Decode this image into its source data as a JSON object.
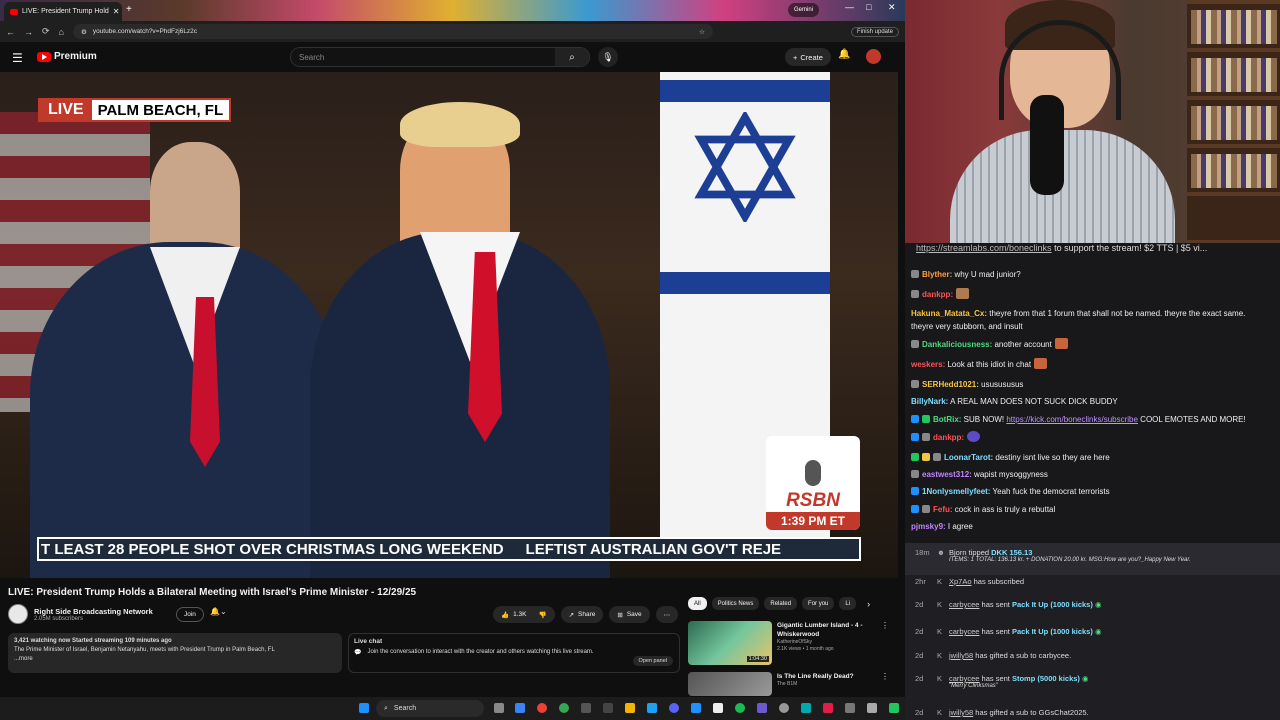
{
  "browser": {
    "tab_title": "LIVE: President Trump Hold",
    "gemini_label": "Gemini",
    "url": "youtube.com/watch?v=PhdFzj6Lz2c",
    "finish_update": "Finish update"
  },
  "youtube": {
    "brand": "Premium",
    "search_placeholder": "Search",
    "create_label": "Create",
    "video": {
      "live_badge": "LIVE",
      "location": "PALM BEACH, FL",
      "rsbn_name": "RSBN",
      "rsbn_time": "1:39 PM ET",
      "ticker_1": "T LEAST 28 PEOPLE SHOT OVER CHRISTMAS LONG WEEKEND",
      "ticker_2": "LEFTIST AUSTRALIAN GOV'T REJE"
    },
    "title": "LIVE: President Trump Holds a Bilateral Meeting with Israel's Prime Minister - 12/29/25",
    "channel": {
      "name": "Right Side Broadcasting Network",
      "subscribers": "2.05M subscribers",
      "join": "Join"
    },
    "actions": {
      "likes": "1.3K",
      "share": "Share",
      "save": "Save"
    },
    "description": {
      "stats": "3,421 watching now  Started streaming 109 minutes ago",
      "text": "The Prime Minister of Israel, Benjamin Netanyahu, meets with President Trump in Palm Beach, FL",
      "more": "...more"
    },
    "live_chat": {
      "title": "Live chat",
      "body": "Join the conversation to interact with the creator and others watching this live stream.",
      "open_panel": "Open panel"
    },
    "chips": [
      "All",
      "Politics News",
      "Related",
      "For you",
      "Li"
    ],
    "recommendations": [
      {
        "title": "Gigantic Lumber Island - 4 - Whiskerwood",
        "channel": "KatherineOfSky",
        "meta": "2.1K views • 1 month ago",
        "duration": "1:04:30"
      },
      {
        "title": "Is The Line Really Dead?",
        "channel": "The B1M",
        "meta": "",
        "duration": ""
      }
    ]
  },
  "taskbar": {
    "search": "Search"
  },
  "stream": {
    "banner_link": "https://streamlabs.com/boneclinks",
    "banner_text": " to support the stream! $2 TTS | $5 vi..."
  },
  "chat": [
    {
      "user": "Blyther:",
      "color": "#ff9f43",
      "text": " why U mad junior?"
    },
    {
      "user": "dankpp:",
      "color": "#ff5252",
      "text": ""
    },
    {
      "user": "Hakuna_Matata_Cx:",
      "color": "#f5c542",
      "text": " theyre from that 1 forum that shall not be named. theyre the exact same."
    },
    {
      "user": "",
      "color": "#f5c542",
      "text": "theyre very stubborn, and insult"
    },
    {
      "user": "Dankaliciousness:",
      "color": "#4ade80",
      "text": " another account"
    },
    {
      "user": "weskers:",
      "color": "#ff5252",
      "text": " Look at this idiot in chat"
    },
    {
      "user": "SERHedd1021:",
      "color": "#f5c542",
      "text": " ususususus"
    },
    {
      "user": "BillyNark:",
      "color": "#7fdfff",
      "text": " A REAL MAN DOES NOT SUCK DICK BUDDY"
    },
    {
      "user": "BotRix:",
      "color": "#4ade80",
      "text": " SUB NOW! ",
      "link": "https://kick.com/boneclinks/subscribe",
      "after": " COOL EMOTES AND MORE!"
    },
    {
      "user": "dankpp:",
      "color": "#ff5252",
      "text": ""
    },
    {
      "user": "LoonarTarot:",
      "color": "#7fdfff",
      "text": " destiny isnt live so they are here"
    },
    {
      "user": "eastwest312:",
      "color": "#c084fc",
      "text": " wapist mysoggyness"
    },
    {
      "user": "1Nonlysmellyfeet:",
      "color": "#7fdfff",
      "text": " Yeah fuck the democrat terrorists"
    },
    {
      "user": "Fefu:",
      "color": "#ff5252",
      "text": " cock in ass is truly a rebuttal"
    },
    {
      "user": "pjmsky9:",
      "color": "#c084fc",
      "text": " I agree"
    }
  ],
  "events": [
    {
      "time": "18m",
      "user": "Bjorn",
      "action": " tipped ",
      "highlight": "DKK 156.13",
      "sub": "ITEMS: 1 TOTAL: 136.13 kr. + DONATION 20.00 kr. MSG:How are you?_Happy New Year."
    },
    {
      "time": "2hr",
      "user": "Xp7Ao",
      "action": " has subscribed",
      "highlight": ""
    },
    {
      "time": "2d",
      "user": "carbycee",
      "action": " has sent ",
      "highlight": "Pack It Up (1000 kicks)"
    },
    {
      "time": "2d",
      "user": "carbycee",
      "action": " has sent ",
      "highlight": "Pack It Up (1000 kicks)"
    },
    {
      "time": "2d",
      "user": "jwilly58",
      "action": " has gifted a sub to ",
      "highlight": "carbycee."
    },
    {
      "time": "2d",
      "user": "carbycee",
      "action": " has sent ",
      "highlight": "Stomp (5000 kicks)",
      "sub": "\"Merry Clinksmas\""
    },
    {
      "time": "2d",
      "user": "jwilly58",
      "action": " has gifted a sub to ",
      "highlight": "GGsChat2025."
    }
  ]
}
